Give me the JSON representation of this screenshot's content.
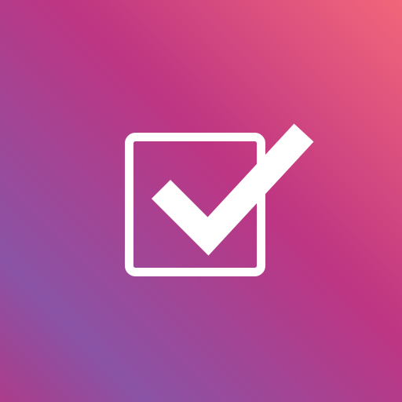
{
  "icon": {
    "name": "checkbox-checked-icon",
    "glyph_color": "#ffffff",
    "background": {
      "type": "linear-gradient",
      "colors": [
        "#f2667a",
        "#be3583",
        "#8a53a5",
        "#ab3c8a"
      ]
    }
  }
}
